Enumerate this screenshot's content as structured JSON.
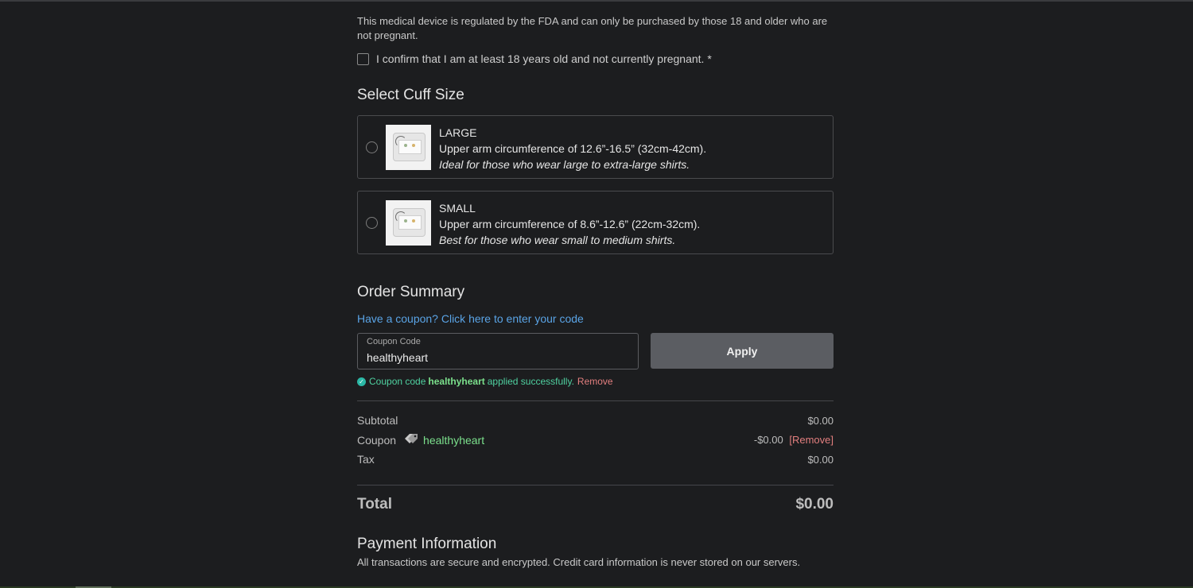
{
  "notice": "This medical device is regulated by the FDA and can only be purchased by those 18 and older who are not pregnant.",
  "confirm_label": "I confirm that I am at least 18 years old and not currently pregnant. *",
  "cuff_section": {
    "title": "Select Cuff Size",
    "options": [
      {
        "name": "LARGE",
        "range": "Upper arm circumference of 12.6”-16.5” (32cm-42cm).",
        "note": "Ideal for those who wear large to extra-large shirts."
      },
      {
        "name": "SMALL",
        "range": "Upper arm circumference of 8.6”-12.6” (22cm-32cm).",
        "note": "Best for those who wear small to medium shirts."
      }
    ]
  },
  "order_summary": {
    "title": "Order Summary",
    "coupon_link": "Have a coupon? Click here to enter your code",
    "coupon_field_label": "Coupon Code",
    "coupon_value": "healthyheart",
    "apply_label": "Apply",
    "success_prefix": "Coupon code",
    "success_code": "healthyheart",
    "success_suffix": "applied successfully.",
    "success_remove": "Remove",
    "subtotal_label": "Subtotal",
    "subtotal_value": "$0.00",
    "coupon_label": "Coupon",
    "coupon_code": "healthyheart",
    "coupon_value_amount": "-$0.00",
    "coupon_remove": "[Remove]",
    "tax_label": "Tax",
    "tax_value": "$0.00",
    "total_label": "Total",
    "total_value": "$0.00"
  },
  "payment": {
    "title": "Payment Information",
    "subtitle": "All transactions are secure and encrypted. Credit card information is never stored on our servers."
  },
  "colors": {
    "background": "#1c1d1f",
    "link": "#5aa4e6",
    "success": "#4fd1a0",
    "remove": "#e37f7f",
    "coupon_code": "#7be08c"
  }
}
